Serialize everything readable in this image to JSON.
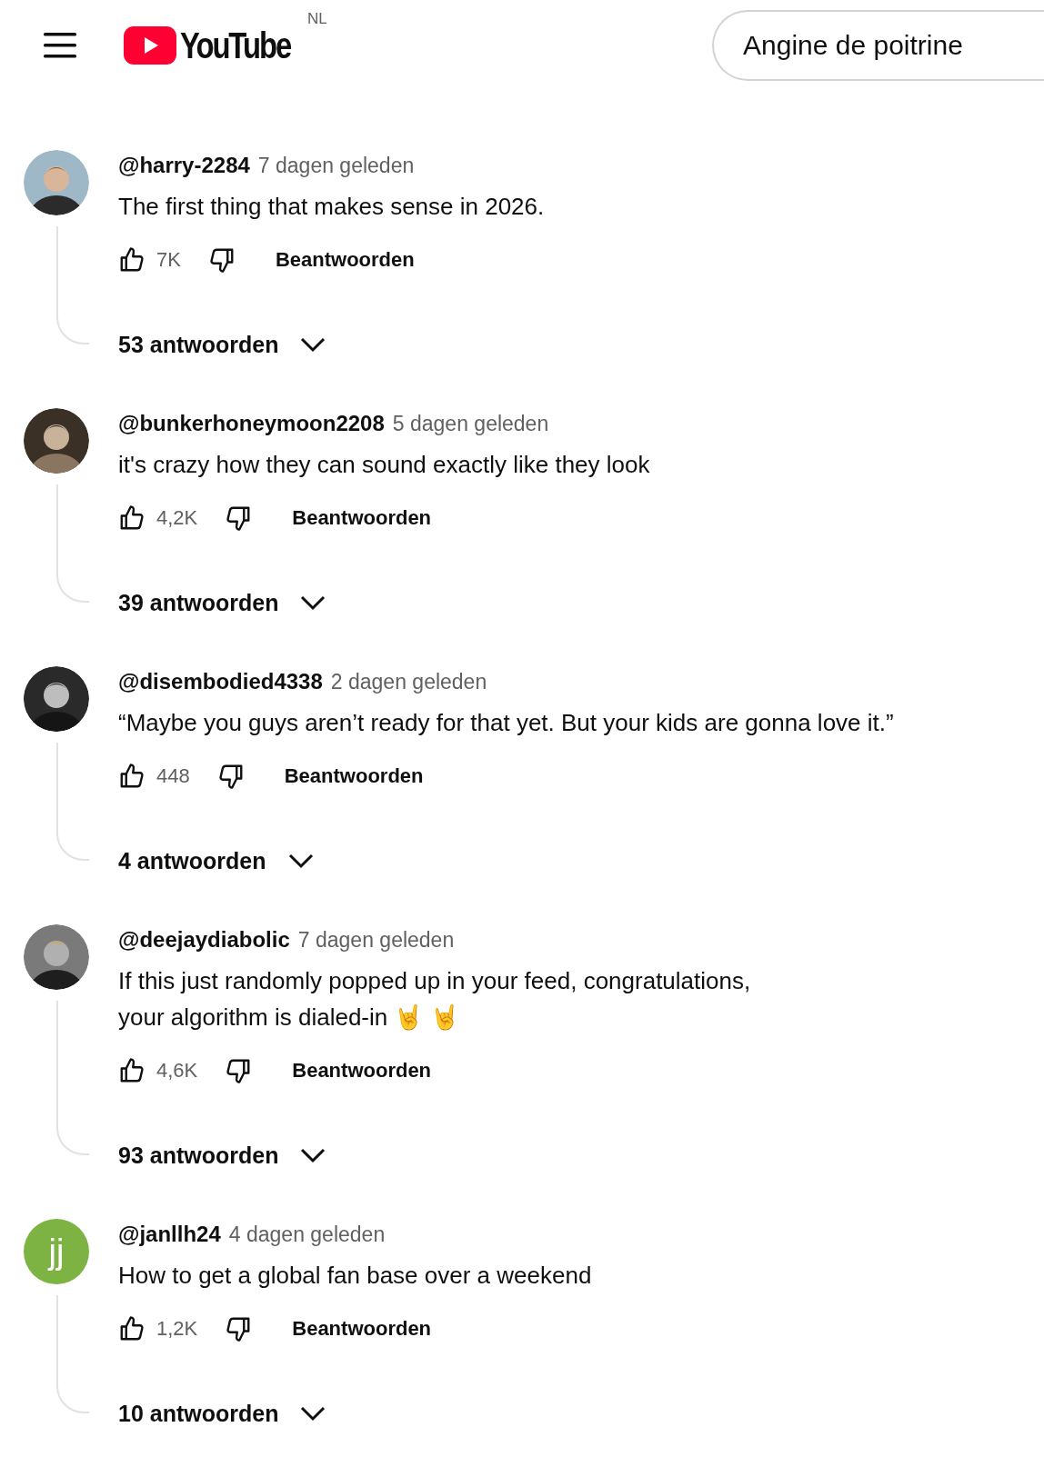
{
  "header": {
    "logo_text": "YouTube",
    "region": "NL",
    "search": {
      "value": "Angine de poitrine"
    }
  },
  "comments": [
    {
      "author": "@harry-2284",
      "time": "7 dagen geleden",
      "text": "The first thing that makes sense in 2026.",
      "likes": "7K",
      "reply_label": "Beantwoorden",
      "replies": "53 antwoorden"
    },
    {
      "author": "@bunkerhoneymoon2208",
      "time": "5 dagen geleden",
      "text": "it's crazy how they can sound exactly like they look",
      "likes": "4,2K",
      "reply_label": "Beantwoorden",
      "replies": "39 antwoorden"
    },
    {
      "author": "@disembodied4338",
      "time": "2 dagen geleden",
      "text": "“Maybe you guys aren’t ready for that yet. But your kids are gonna love it.”",
      "likes": "448",
      "reply_label": "Beantwoorden",
      "replies": "4 antwoorden"
    },
    {
      "author": "@deejaydiabolic",
      "time": "7 dagen geleden",
      "text": "If this just randomly popped up in your feed, congratulations,\nyour algorithm is dialed-in 🤘 🤘",
      "likes": "4,6K",
      "reply_label": "Beantwoorden",
      "replies": "93 antwoorden"
    },
    {
      "author": "@janllh24",
      "time": "4 dagen geleden",
      "text": "How to get a global fan base over a weekend",
      "likes": "1,2K",
      "reply_label": "Beantwoorden",
      "replies": "10 antwoorden",
      "avatar": {
        "kind": "letter",
        "letters": "jj",
        "color": "#7cb342"
      }
    }
  ]
}
